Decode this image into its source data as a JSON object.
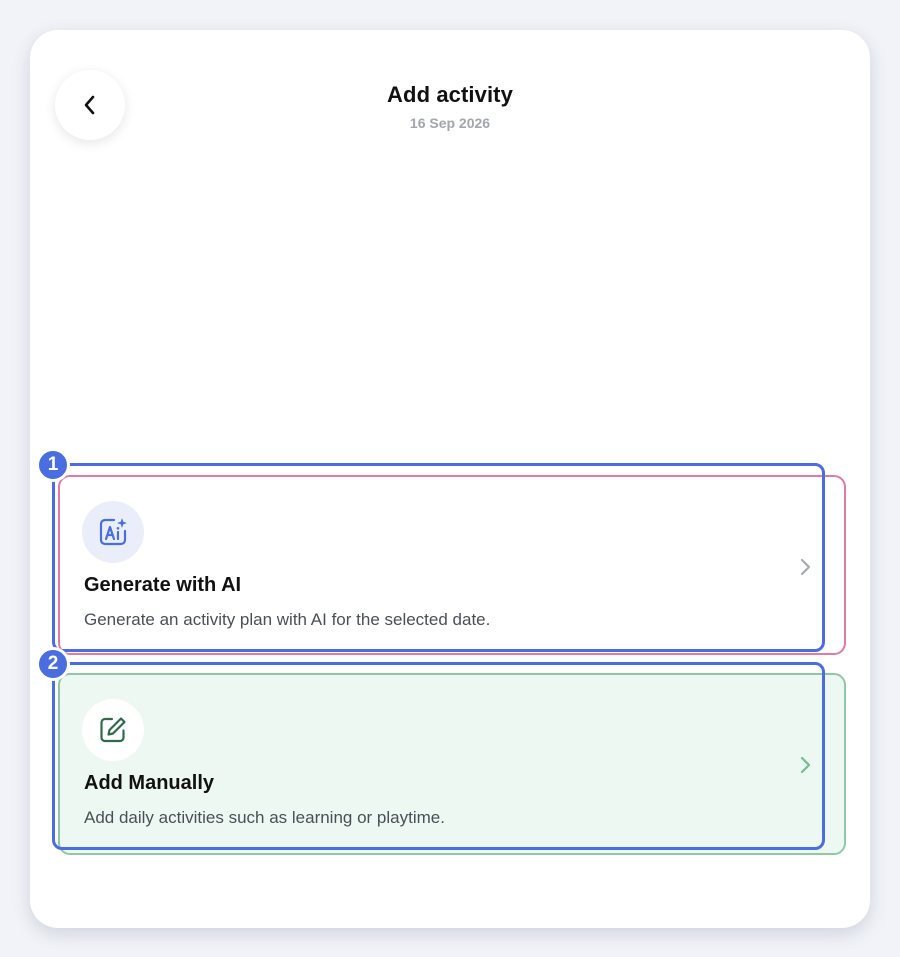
{
  "header": {
    "title": "Add activity",
    "date": "16 Sep 2026"
  },
  "options": [
    {
      "title": "Generate with AI",
      "description": "Generate an activity plan with AI for the selected date.",
      "icon": "ai-sparkle-icon",
      "accent": "#4a6de0"
    },
    {
      "title": "Add Manually",
      "description": "Add daily activities such as learning or playtime.",
      "icon": "edit-icon",
      "accent": "#2f6b4a"
    }
  ],
  "annotations": [
    "1",
    "2"
  ],
  "colors": {
    "annotation": "#4a6de0",
    "ai_card_border": "#e07aa7",
    "manual_card_border": "#8fc9a4",
    "manual_card_bg": "#eef8f2"
  }
}
